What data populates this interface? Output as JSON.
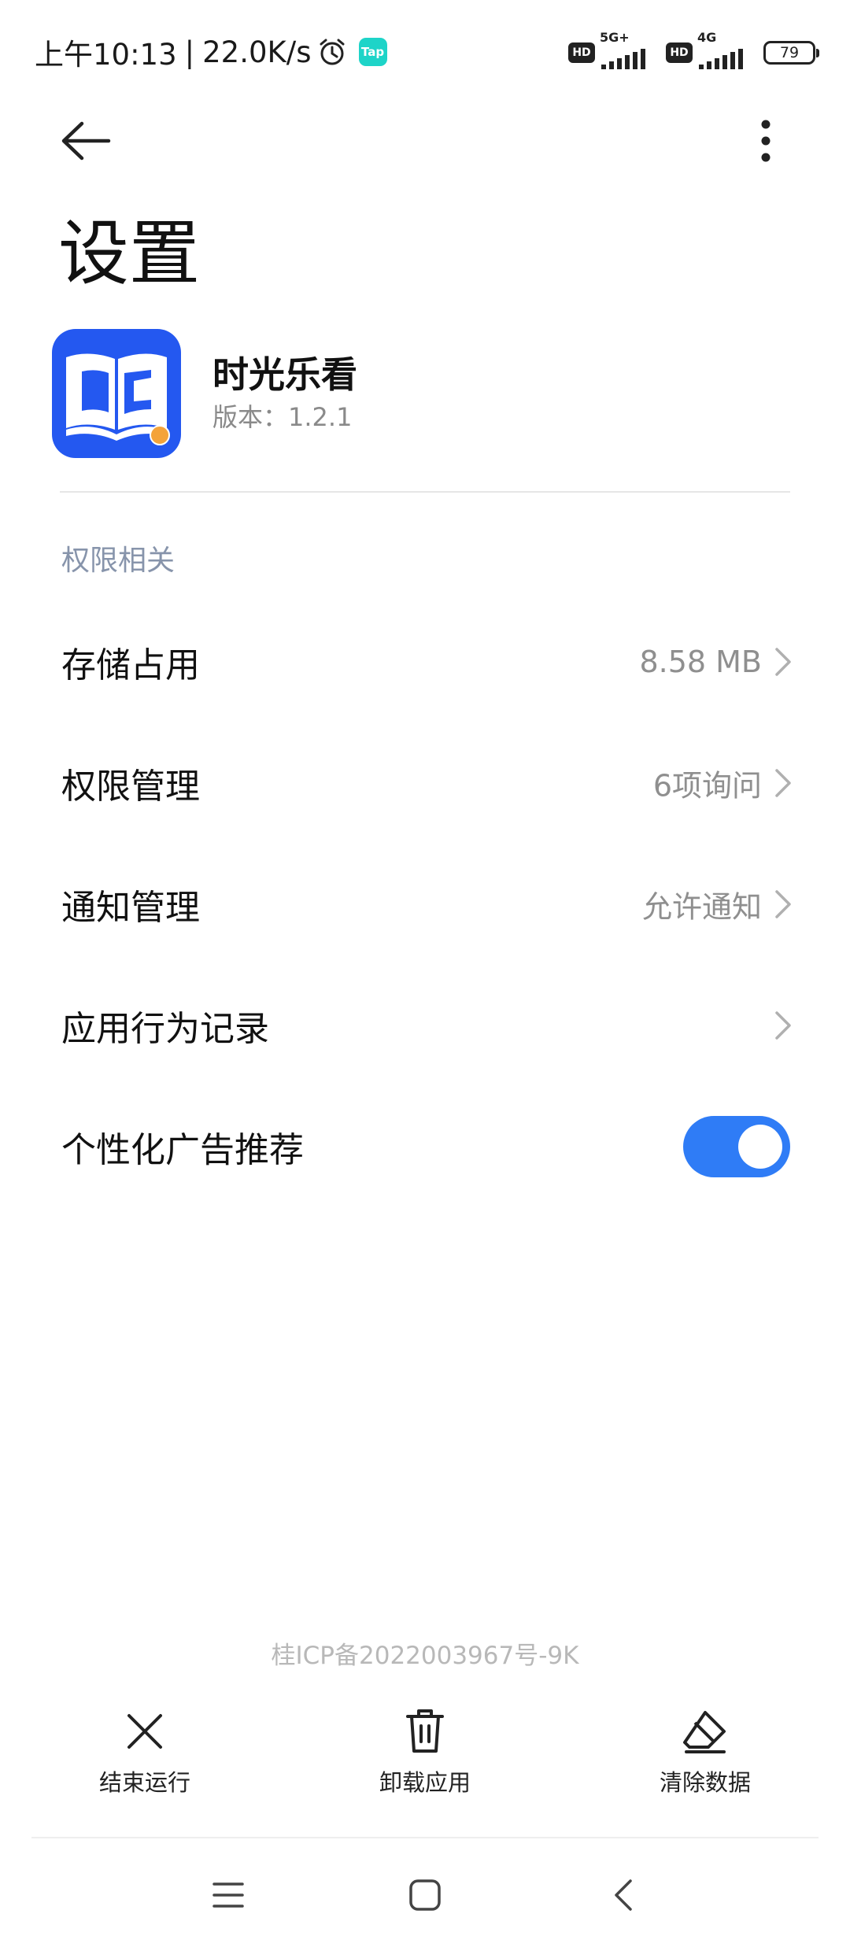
{
  "status_bar": {
    "time": "上午10:13",
    "separator": "|",
    "net_speed": "22.0K/s",
    "tap_badge": "Tap",
    "hd_label": "HD",
    "network_1": "5G+",
    "network_2": "4G",
    "battery": "79",
    "icons": [
      "alarm-icon",
      "signal-icon",
      "battery-icon"
    ]
  },
  "top_bar": {
    "back_icon": "arrow-left-icon",
    "more_icon": "more-vertical-icon"
  },
  "page_title": "设置",
  "app": {
    "name": "时光乐看",
    "version": "版本：1.2.1",
    "icon": "book-icon",
    "icon_color": "#2458f0"
  },
  "section": {
    "header": "权限相关",
    "items": [
      {
        "label": "存储占用",
        "value": "8.58 MB"
      },
      {
        "label": "权限管理",
        "value": "6项询问"
      },
      {
        "label": "通知管理",
        "value": "允许通知"
      },
      {
        "label": "应用行为记录",
        "value": ""
      },
      {
        "label": "个性化广告推荐",
        "toggle": true
      }
    ]
  },
  "footer": {
    "icp": "桂ICP备2022003967号-9K",
    "actions": [
      {
        "label": "结束运行",
        "icon": "close-icon"
      },
      {
        "label": "卸载应用",
        "icon": "trash-icon"
      },
      {
        "label": "清除数据",
        "icon": "eraser-icon"
      }
    ]
  },
  "nav_bar": {
    "icons": [
      "menu-icon",
      "home-icon",
      "back-icon"
    ]
  },
  "colors": {
    "accent": "#2f7cf6",
    "section_header": "#8794ab",
    "secondary_text": "#8f8f8f"
  }
}
